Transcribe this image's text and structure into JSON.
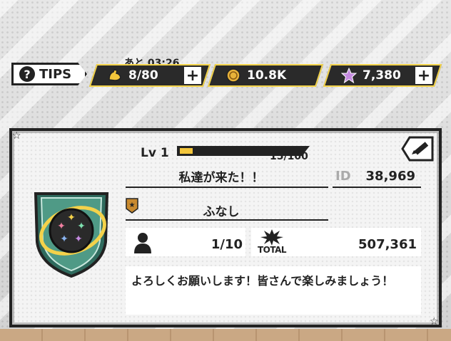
{
  "topbar": {
    "tips_label": "TIPS",
    "timer": "あと 03:26",
    "stamina": "8/80",
    "coins": "10.8K",
    "gems": "7,380"
  },
  "profile": {
    "level_label": "Lv 1",
    "xp_text": "15/100",
    "xp_progress": 0.15,
    "name": "私達が来た！！",
    "id_label": "ID",
    "id_value": "38,969",
    "guild": "ふなし",
    "members": "1/10",
    "total_label": "TOTAL",
    "total_value": "507,361",
    "comment": "よろしくお願いします！皆さんで楽しみましょう！"
  },
  "colors": {
    "accent": "#f3d34a",
    "dark": "#222222",
    "emblem": "#2f6b5e"
  }
}
